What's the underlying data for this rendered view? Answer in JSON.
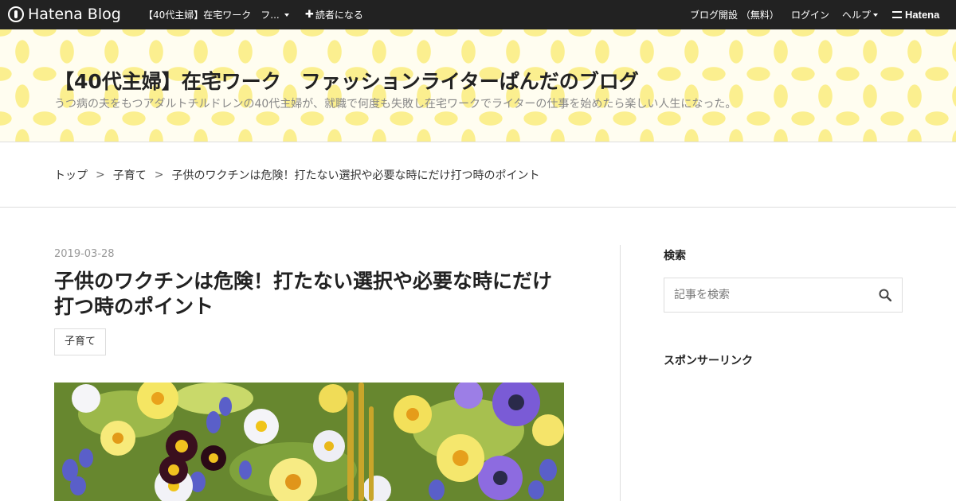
{
  "navbar": {
    "brand": "Hatena Blog",
    "blog_menu": "【40代主婦】在宅ワーク　フ...",
    "subscribe": "読者になる",
    "create_blog": "ブログ開設 （無料）",
    "login": "ログイン",
    "help": "ヘルプ",
    "hatena": "Hatena"
  },
  "header": {
    "title": "【40代主婦】在宅ワーク　ファッションライターぱんだのブログ",
    "description": "うつ病の夫をもつアダルトチルドレンの40代主婦が、就職で何度も失敗し在宅ワークでライターの仕事を始めたら楽しい人生になった。"
  },
  "breadcrumb": {
    "items": [
      "トップ",
      "子育て",
      "子供のワクチンは危険！打たない選択や必要な時にだけ打つ時のポイント"
    ],
    "separator": ">"
  },
  "article": {
    "date": "2019-03-28",
    "title": "子供のワクチンは危険！打たない選択や必要な時にだけ打つ時のポイント",
    "category": "子育て"
  },
  "sidebar": {
    "search_heading": "検索",
    "search_placeholder": "記事を検索",
    "sponsor_heading": "スポンサーリンク"
  },
  "colors": {
    "navbar_bg": "#222222",
    "header_pattern": "#fbef8f",
    "header_bg": "#fffdf0"
  },
  "icons": {
    "search": "search-icon",
    "dropdown": "caret-down-icon",
    "plus": "plus-icon"
  }
}
